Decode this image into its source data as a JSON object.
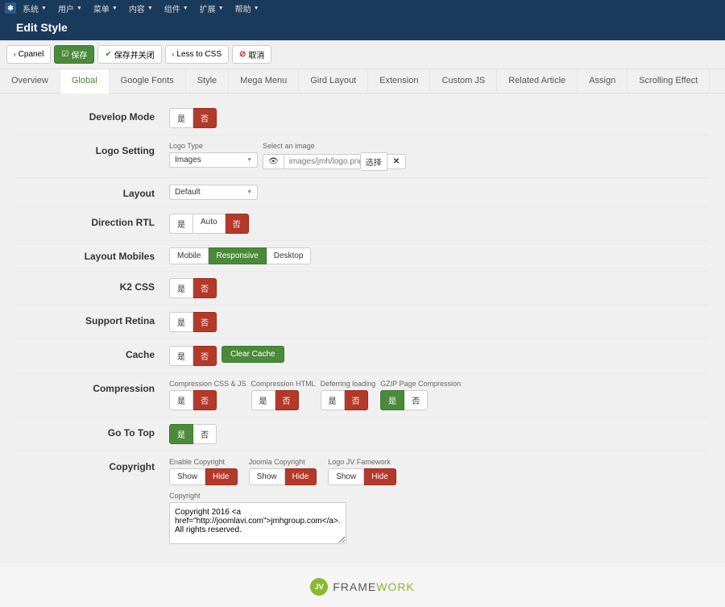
{
  "topmenu": [
    "系统",
    "用户",
    "菜单",
    "内容",
    "组件",
    "扩展",
    "帮助"
  ],
  "title": "Edit Style",
  "toolbar": {
    "cpanel": "Cpanel",
    "save": "保存",
    "saveclose": "保存并关闭",
    "less": "Less to CSS",
    "cancel": "取消"
  },
  "tabs": [
    "Overview",
    "Global",
    "Google Fonts",
    "Style",
    "Mega Menu",
    "Gird Layout",
    "Extension",
    "Custom JS",
    "Related Article",
    "Assign",
    "Scrolling Effect"
  ],
  "activeTab": 1,
  "labels": {
    "develop": "Develop Mode",
    "logo": "Logo Setting",
    "layout": "Layout",
    "rtl": "Direction RTL",
    "mobiles": "Layout Mobiles",
    "k2": "K2 CSS",
    "retina": "Support Retina",
    "cache": "Cache",
    "compression": "Compression",
    "gotop": "Go To Top",
    "copyright": "Copyright"
  },
  "opts": {
    "yes": "是",
    "no": "否",
    "auto": "Auto",
    "mobile": "Mobile",
    "responsive": "Responsive",
    "desktop": "Desktop",
    "show": "Show",
    "hide": "Hide"
  },
  "logo": {
    "typeLabel": "Logo Type",
    "typeValue": "Images",
    "imgLabel": "Select an image",
    "imgPath": "images/jmh/logo.png",
    "browse": "选择"
  },
  "layout": {
    "value": "Default"
  },
  "cache": {
    "clear": "Clear Cache"
  },
  "compression": {
    "cssjs": "Compression CSS & JS",
    "html": "Compression HTML",
    "defer": "Deferring loading",
    "gzip": "GZIP Page Compression"
  },
  "copyright": {
    "enable": "Enable Copyright",
    "joomla": "Joomla Copyright",
    "jvfw": "Logo JV Famework",
    "txtLabel": "Copyright",
    "txt": "Copyright 2016 <a href=\"http://joomlavi.com\">jmhgroup.com</a>. All rights reserved."
  },
  "footer": {
    "badge": "JV",
    "f1": "FRAME",
    "f2": "WORK"
  }
}
